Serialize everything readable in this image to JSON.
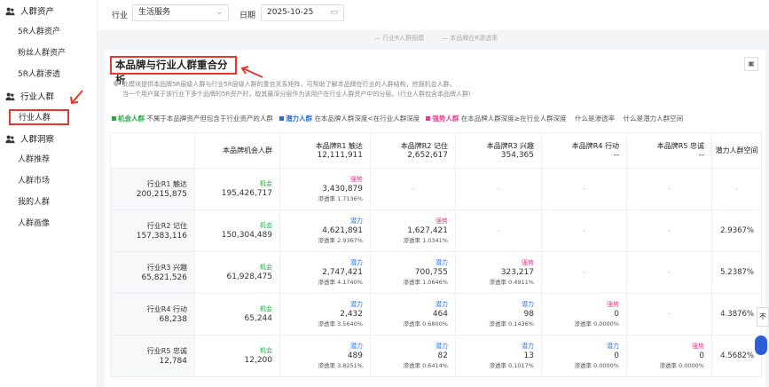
{
  "sidebar": {
    "groups": [
      {
        "label": "人群资产",
        "items": [
          "5R人群资产",
          "粉丝人群资产",
          "5R人群渗透"
        ]
      },
      {
        "label": "行业人群",
        "items": [
          "行业人群"
        ]
      },
      {
        "label": "人群洞察",
        "items": [
          "人群推荐",
          "人群市场",
          "我的人群",
          "人群画像"
        ]
      }
    ]
  },
  "filters": {
    "industry_label": "行业",
    "industry_value": "生活服务",
    "date_label": "日期",
    "date_value": "2025-10-25"
  },
  "legend_strip": {
    "item1": "行业R人群规模",
    "item2": "本品牌在R渗透率"
  },
  "panel": {
    "title": "本品牌与行业人群重合分析",
    "desc_line1": "此模块提供本品牌5R层级人群与行业5R层级人群的重合关系矩阵，可帮助了解本品牌在行业的人群结构，挖掘机会人群。",
    "desc_line2": "当一个用户属于该行业下多个品牌的5R资产时，取其最深分层作为该用户在行业人群资产中的分层。(行业人群包含本品牌人群)",
    "legend": {
      "opp_name": "机会人群",
      "opp_desc": "不属于本品牌资产但包含于行业资产的人群",
      "pot_name": "潜力人群",
      "pot_desc": "在本品牌人群深度<在行业人群深度",
      "weak_name": "强势人群",
      "weak_desc": "在本品牌人群深度≥在行业人群深度",
      "q1": "什么是渗透率",
      "q2": "什么是潜力人群空间"
    }
  },
  "table": {
    "headers": [
      {
        "label": "",
        "num": ""
      },
      {
        "label": "本品牌机会人群",
        "num": ""
      },
      {
        "label": "本品牌R1 触达",
        "num": "12,111,911"
      },
      {
        "label": "本品牌R2 记住",
        "num": "2,652,617"
      },
      {
        "label": "本品牌R3 兴趣",
        "num": "354,365"
      },
      {
        "label": "本品牌R4 行动",
        "num": "--"
      },
      {
        "label": "本品牌R5 忠诚",
        "num": "--"
      },
      {
        "label": "潜力人群空间",
        "num": ""
      }
    ],
    "rows": [
      {
        "label": "行业R1 触达",
        "num": "200,215,875",
        "opp": {
          "tag": "机会",
          "val": "195,426,717"
        },
        "cells": [
          {
            "tag": "强势",
            "kind": "weak",
            "val": "3,430,879",
            "rate": "渗透率 1.7136%"
          },
          {
            "empty": "-"
          },
          {
            "empty": "-"
          },
          {
            "empty": "-"
          },
          {
            "empty": "-"
          }
        ],
        "space": "-"
      },
      {
        "label": "行业R2 记住",
        "num": "157,383,116",
        "opp": {
          "tag": "机会",
          "val": "150,304,489"
        },
        "cells": [
          {
            "tag": "潜力",
            "kind": "pot",
            "val": "4,621,891",
            "rate": "渗透率 2.9367%"
          },
          {
            "tag": "强势",
            "kind": "weak",
            "val": "1,627,421",
            "rate": "渗透率 1.0341%"
          },
          {
            "empty": "-"
          },
          {
            "empty": "-"
          },
          {
            "empty": "-"
          }
        ],
        "space": "2.9367%"
      },
      {
        "label": "行业R3 兴趣",
        "num": "65,821,526",
        "opp": {
          "tag": "机会",
          "val": "61,928,475"
        },
        "cells": [
          {
            "tag": "潜力",
            "kind": "pot",
            "val": "2,747,421",
            "rate": "渗透率 4.1740%"
          },
          {
            "tag": "潜力",
            "kind": "pot",
            "val": "700,755",
            "rate": "渗透率 1.0646%"
          },
          {
            "tag": "强势",
            "kind": "weak",
            "val": "323,217",
            "rate": "渗透率 0.4911%"
          },
          {
            "empty": "-"
          },
          {
            "empty": "-"
          }
        ],
        "space": "5.2387%"
      },
      {
        "label": "行业R4 行动",
        "num": "68,238",
        "opp": {
          "tag": "机会",
          "val": "65,244"
        },
        "cells": [
          {
            "tag": "潜力",
            "kind": "pot",
            "val": "2,432",
            "rate": "渗透率 3.5640%"
          },
          {
            "tag": "潜力",
            "kind": "pot",
            "val": "464",
            "rate": "渗透率 0.6800%"
          },
          {
            "tag": "潜力",
            "kind": "pot",
            "val": "98",
            "rate": "渗透率 0.1436%"
          },
          {
            "tag": "强势",
            "kind": "weak",
            "val": "0",
            "rate": "渗透率 0.0000%"
          },
          {
            "empty": "-"
          }
        ],
        "space": "4.3876%"
      },
      {
        "label": "行业R5 忠诚",
        "num": "12,784",
        "opp": {
          "tag": "机会",
          "val": "12,200"
        },
        "cells": [
          {
            "tag": "潜力",
            "kind": "pot",
            "val": "489",
            "rate": "渗透率 3.8251%"
          },
          {
            "tag": "潜力",
            "kind": "pot",
            "val": "82",
            "rate": "渗透率 0.6414%"
          },
          {
            "tag": "潜力",
            "kind": "pot",
            "val": "13",
            "rate": "渗透率 0.1017%"
          },
          {
            "tag": "潜力",
            "kind": "pot",
            "val": "0",
            "rate": "渗透率 0.0000%"
          },
          {
            "tag": "强势",
            "kind": "weak",
            "val": "0",
            "rate": "渗透率 0.0000%"
          }
        ],
        "space": "4.5682%"
      }
    ]
  },
  "float_btn": "不",
  "colors": {
    "accent": "#e8382b",
    "opp": "#28a745",
    "pot": "#1f6fe5",
    "weak": "#e83e8c"
  }
}
